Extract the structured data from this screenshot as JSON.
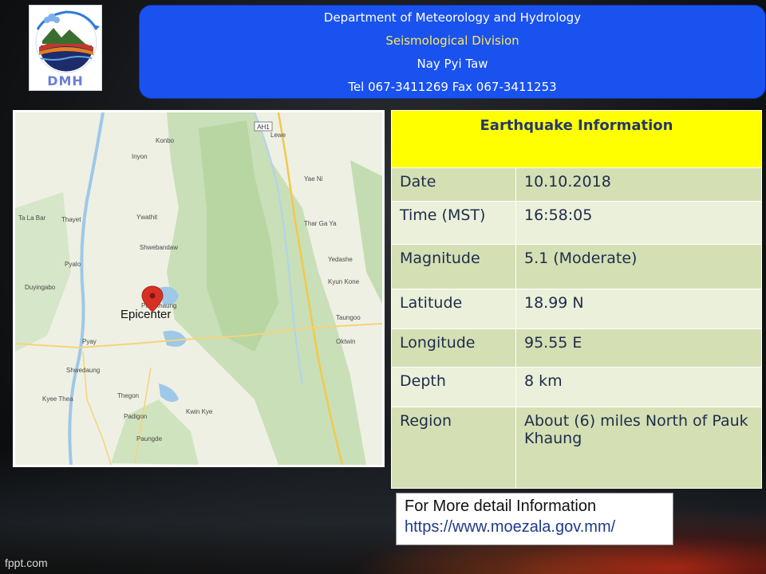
{
  "logo": {
    "text": "DMH"
  },
  "header": {
    "line1": "Department of Meteorology and Hydrology",
    "line2": "Seismological Division",
    "line3": "Nay Pyi Taw",
    "line4": "Tel 067-3411269 Fax 067-3411253"
  },
  "map": {
    "epicenter_label": "Epicenter",
    "place_names": [
      "Konbo",
      "Inyon",
      "Lewe",
      "Yae Ni",
      "Thayet",
      "Ta La Bar",
      "Ywathit",
      "Shwebandaw",
      "Thar Ga Ya",
      "Pyalo",
      "Yedashe",
      "Duyingabo",
      "Kyun Kone",
      "Paukkhaung",
      "Taungoo",
      "Pyay",
      "Oktwin",
      "Shwedaung",
      "Kyee Thea",
      "Thegon",
      "Kwin Kye",
      "Padigon",
      "Paungde"
    ],
    "road_labels": [
      "AH1",
      "AH1"
    ]
  },
  "info": {
    "title": "Earthquake Information",
    "rows": [
      {
        "label": "Date",
        "value": "10.10.2018"
      },
      {
        "label": "Time (MST)",
        "value": "16:58:05"
      },
      {
        "label": "Magnitude",
        "value": "5.1 (Moderate)"
      },
      {
        "label": "Latitude",
        "value": "18.99 N"
      },
      {
        "label": "Longitude",
        "value": "95.55 E"
      },
      {
        "label": "Depth",
        "value": "8 km"
      },
      {
        "label": "Region",
        "value": "About (6)  miles  North of Pauk Khaung"
      }
    ]
  },
  "note": {
    "line1": "For More detail Information",
    "link": "https://www.moezala.gov.mm/"
  },
  "footer": {
    "brand": "fppt.com"
  },
  "colors": {
    "header_bg": "#1a52f0",
    "header_accent": "#ffe85a",
    "title_bg": "#ffff00",
    "row_dark": "#d4dfb4",
    "row_light": "#ebf0da",
    "epicenter_pin": "#d93025"
  }
}
